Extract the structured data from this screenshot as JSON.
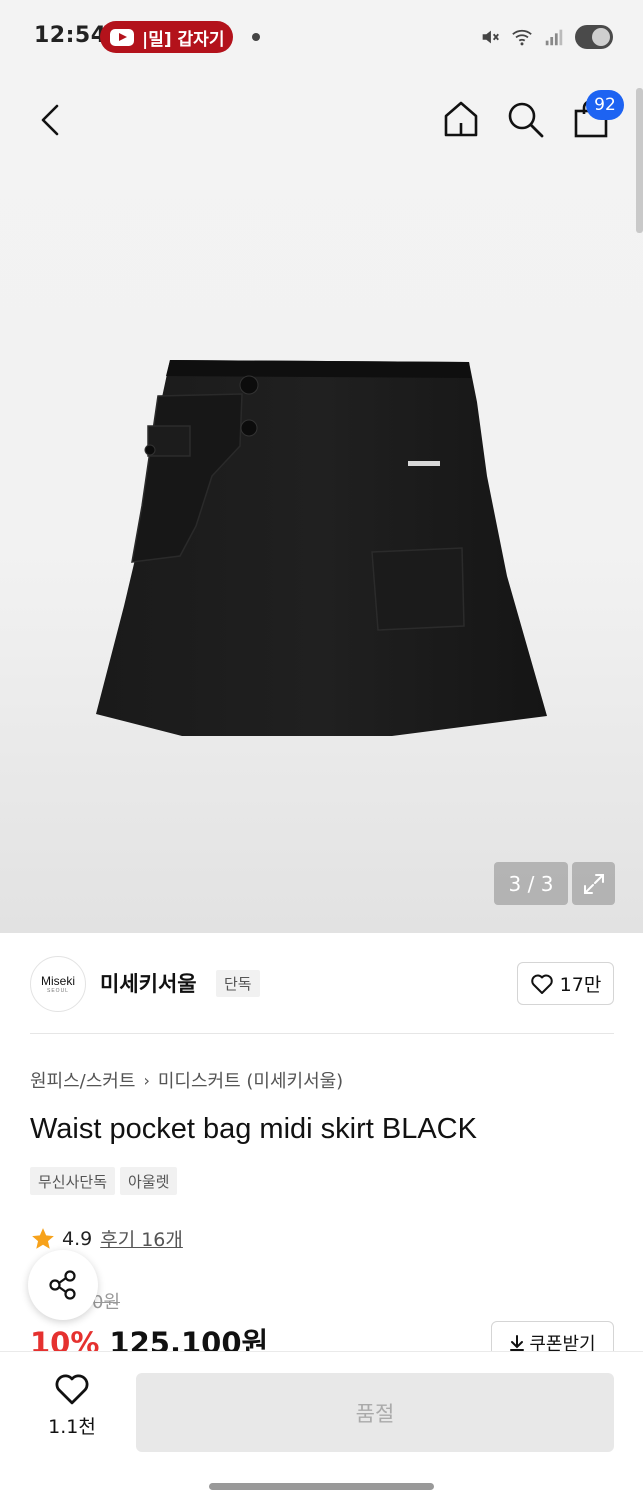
{
  "status_bar": {
    "time": "12:54",
    "notification_text": "|밀] 갑자기",
    "icons": [
      "mute-icon",
      "wifi-icon",
      "signal-icon",
      "battery-icon"
    ]
  },
  "nav": {
    "back_icon": "chevron-left-icon",
    "home_icon": "home-icon",
    "search_icon": "search-icon",
    "cart_icon": "shopping-bag-icon",
    "cart_count": "92"
  },
  "gallery": {
    "counter": "3 / 3",
    "expand_icon": "expand-icon"
  },
  "brand": {
    "logo_text": "Miseki",
    "logo_sub": "SEOUL",
    "name": "미세키서울",
    "tag": "단독",
    "like_count": "17만"
  },
  "product": {
    "breadcrumb": [
      "원피스/스커트",
      "미디스커트 (미세키서울)"
    ],
    "title": "Waist pocket bag midi skirt BLACK",
    "tags": [
      "무신사단독",
      "아울렛"
    ],
    "rating": "4.9",
    "review_link": "후기 16개",
    "original_price_visible": "0원",
    "discount": "10%",
    "sale_price": "125,100원",
    "coupon_label": "쿠폰받기"
  },
  "bottom_bar": {
    "wish_count": "1.1천",
    "soldout_label": "품절"
  },
  "colors": {
    "accent_blue": "#1d63f2",
    "discount_red": "#e5312f",
    "star_orange": "#f7a21b",
    "youtube_red": "#b3121b"
  }
}
